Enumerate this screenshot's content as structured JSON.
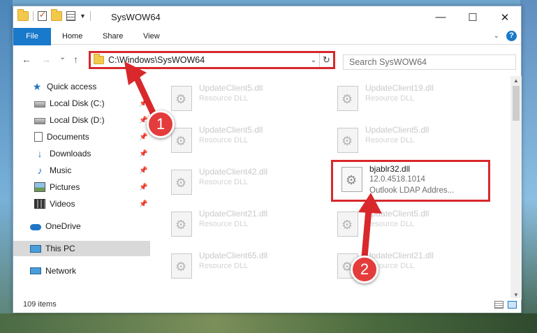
{
  "window": {
    "title": "SysWOW64",
    "controls": {
      "minimize": "—",
      "maximize": "☐",
      "close": "✕"
    }
  },
  "ribbon": {
    "tabs": [
      "File",
      "Home",
      "Share",
      "View"
    ],
    "help": "?"
  },
  "navigation": {
    "back": "←",
    "forward": "→",
    "recent": "⌄",
    "up": "↑",
    "address": "C:\\Windows\\SysWOW64",
    "refresh": "↻",
    "search_placeholder": "Search SysWOW64"
  },
  "sidebar": {
    "quick_access": "Quick access",
    "items": [
      {
        "label": "Local Disk (C:)",
        "icon": "disk-icon",
        "pinned": true
      },
      {
        "label": "Local Disk (D:)",
        "icon": "disk-icon",
        "pinned": true
      },
      {
        "label": "Documents",
        "icon": "documents-icon",
        "pinned": true
      },
      {
        "label": "Downloads",
        "icon": "downloads-icon",
        "pinned": true
      },
      {
        "label": "Music",
        "icon": "music-icon",
        "pinned": true
      },
      {
        "label": "Pictures",
        "icon": "pictures-icon",
        "pinned": true
      },
      {
        "label": "Videos",
        "icon": "videos-icon",
        "pinned": true
      }
    ],
    "onedrive": "OneDrive",
    "this_pc": "This PC",
    "network": "Network"
  },
  "files": [
    {
      "name": "UpdateClient5.dll",
      "type": "Resource DLL"
    },
    {
      "name": "UpdateClient19.dll",
      "type": "Resource DLL"
    },
    {
      "name": "UpdateClient5.dll",
      "type": "Resource DLL"
    },
    {
      "name": "UpdateClient5.dll",
      "type": "Resource DLL"
    },
    {
      "name": "UpdateClient42.dll",
      "type": "Resource DLL"
    },
    {
      "name": "UpdateClient21.dll",
      "type": "Resource DLL"
    },
    {
      "name": "UpdateClient5.dll",
      "type": "Resource DLL"
    },
    {
      "name": "UpdateClient65.dll",
      "type": "Resource DLL"
    },
    {
      "name": "UpdateClient21.dll",
      "type": "Resource DLL"
    }
  ],
  "highlighted_file": {
    "name": "bjablr32.dll",
    "version": "12.0.4518.1014",
    "description": "Outlook LDAP Addres..."
  },
  "status": {
    "item_count": "109 items"
  },
  "annotations": {
    "step1": "1",
    "step2": "2",
    "color": "#d8282c"
  }
}
